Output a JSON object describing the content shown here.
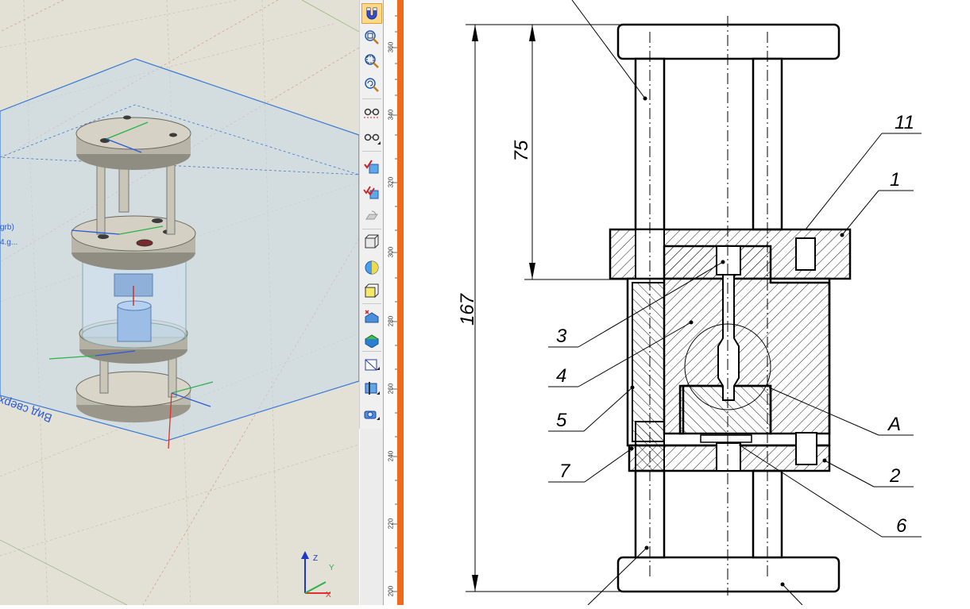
{
  "viewport3d": {
    "side_texts": [
      "grb)",
      "4.g..."
    ],
    "view_label": "Вид сверху",
    "axes": {
      "z": "Z",
      "y": "Y",
      "x": "X"
    },
    "colors": {
      "background": "#e3e1d5",
      "grid_blue": "#3a7bd5",
      "selection": "#2a5bd7"
    }
  },
  "toolbar": {
    "buttons": [
      {
        "name": "magnet-snap-icon",
        "active": true
      },
      {
        "name": "zoom-window-icon"
      },
      {
        "name": "zoom-fit-icon"
      },
      {
        "name": "zoom-previous-icon"
      },
      {
        "name": "view-glasses-icon"
      },
      {
        "name": "view-glasses-menu-icon"
      },
      {
        "name": "check-solid-icon"
      },
      {
        "name": "check-multi-solid-icon"
      },
      {
        "name": "rotate-disabled-icon"
      },
      {
        "name": "wireframe-box-icon"
      },
      {
        "name": "shading-sphere-icon"
      },
      {
        "name": "shaded-box-icon"
      },
      {
        "name": "blue-solid-icon"
      },
      {
        "name": "green-solid-icon"
      },
      {
        "name": "section-view-icon"
      },
      {
        "name": "cut-plane-icon"
      },
      {
        "name": "camera-projector-icon"
      }
    ]
  },
  "ruler": {
    "ticks": [
      "360",
      "340",
      "320",
      "300",
      "280",
      "260",
      "240",
      "220",
      "200"
    ],
    "accent": "#f06a1c"
  },
  "drawing": {
    "dimensions": {
      "overall": "167",
      "upper": "75"
    },
    "callouts": {
      "c11": "11",
      "c1": "1",
      "c3": "3",
      "c4": "4",
      "c5": "5",
      "cA": "A",
      "c7": "7",
      "c2": "2",
      "c6": "6"
    }
  }
}
